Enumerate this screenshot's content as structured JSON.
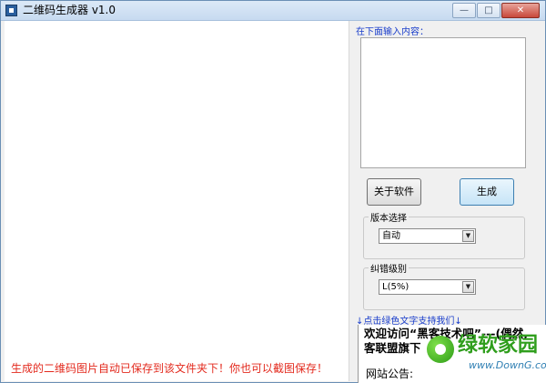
{
  "window": {
    "title": "二维码生成器 v1.0",
    "controls": {
      "minimize": "—",
      "maximize": "□",
      "close": "✕"
    }
  },
  "canvas": {
    "notice": "生成的二维码图片自动已保存到该文件夹下！你也可以截图保存！"
  },
  "panel": {
    "input_label": "在下面输入内容：",
    "input_value": "",
    "about_button": "关于软件",
    "generate_button": "生成",
    "version_group": {
      "label": "版本选择",
      "selected": "自动"
    },
    "ecc_group": {
      "label": "纠错级别",
      "selected": "L(5%)"
    },
    "support_link": "↓点击绿色文字支持我们↓",
    "news": {
      "line1": "欢迎访问“黑客技术吧”---(偶然,",
      "line2": "客联盟旗下",
      "announcement": "网站公告:"
    }
  },
  "watermark": {
    "brand": "绿软家园",
    "url": "www.DownG.com"
  },
  "colors": {
    "link_blue": "#1a3ecb",
    "notice_red": "#e32a1e",
    "watermark_green": "#2f9e1c"
  },
  "icons": {
    "app": "qr-app-icon",
    "dropdown": "chevron-down-icon"
  }
}
